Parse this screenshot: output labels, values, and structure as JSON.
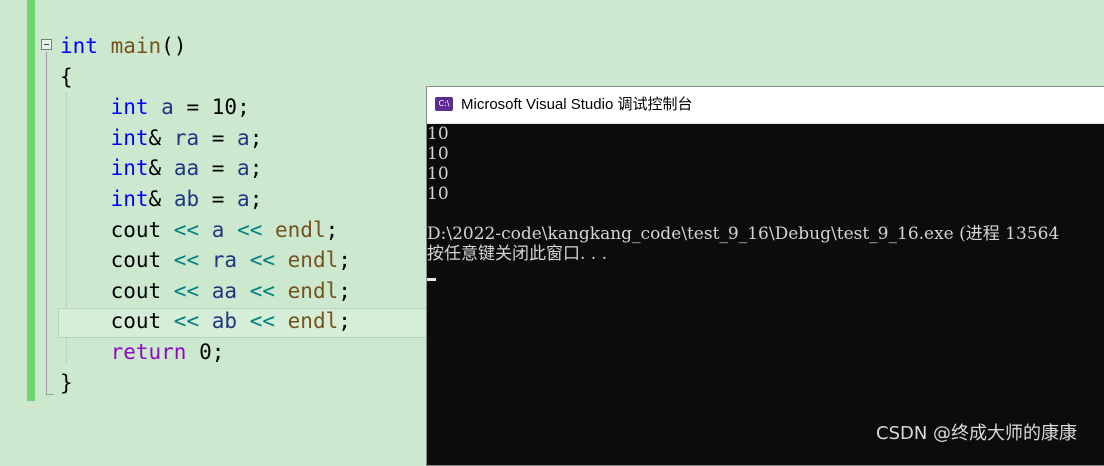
{
  "editor": {
    "lines": [
      {
        "parts": [
          {
            "t": "int",
            "c": "kw"
          },
          {
            "t": " "
          },
          {
            "t": "main",
            "c": "fn"
          },
          {
            "t": "()"
          }
        ]
      },
      {
        "parts": [
          {
            "t": "{"
          }
        ]
      },
      {
        "parts": [
          {
            "t": "    "
          },
          {
            "t": "int",
            "c": "kw"
          },
          {
            "t": " "
          },
          {
            "t": "a",
            "c": "var"
          },
          {
            "t": " = "
          },
          {
            "t": "10",
            "c": "num"
          },
          {
            "t": ";"
          }
        ]
      },
      {
        "parts": [
          {
            "t": "    "
          },
          {
            "t": "int",
            "c": "kw"
          },
          {
            "t": "& "
          },
          {
            "t": "ra",
            "c": "var"
          },
          {
            "t": " = "
          },
          {
            "t": "a",
            "c": "var"
          },
          {
            "t": ";"
          }
        ]
      },
      {
        "parts": [
          {
            "t": "    "
          },
          {
            "t": "int",
            "c": "kw"
          },
          {
            "t": "& "
          },
          {
            "t": "aa",
            "c": "var"
          },
          {
            "t": " = "
          },
          {
            "t": "a",
            "c": "var"
          },
          {
            "t": ";"
          }
        ]
      },
      {
        "parts": [
          {
            "t": "    "
          },
          {
            "t": "int",
            "c": "kw"
          },
          {
            "t": "& "
          },
          {
            "t": "ab",
            "c": "var"
          },
          {
            "t": " = "
          },
          {
            "t": "a",
            "c": "var"
          },
          {
            "t": ";"
          }
        ]
      },
      {
        "parts": [
          {
            "t": "    cout "
          },
          {
            "t": "<<",
            "c": "op"
          },
          {
            "t": " "
          },
          {
            "t": "a",
            "c": "var"
          },
          {
            "t": " "
          },
          {
            "t": "<<",
            "c": "op"
          },
          {
            "t": " "
          },
          {
            "t": "endl",
            "c": "fn"
          },
          {
            "t": ";"
          }
        ]
      },
      {
        "parts": [
          {
            "t": "    cout "
          },
          {
            "t": "<<",
            "c": "op"
          },
          {
            "t": " "
          },
          {
            "t": "ra",
            "c": "var"
          },
          {
            "t": " "
          },
          {
            "t": "<<",
            "c": "op"
          },
          {
            "t": " "
          },
          {
            "t": "endl",
            "c": "fn"
          },
          {
            "t": ";"
          }
        ]
      },
      {
        "parts": [
          {
            "t": "    cout "
          },
          {
            "t": "<<",
            "c": "op"
          },
          {
            "t": " "
          },
          {
            "t": "aa",
            "c": "var"
          },
          {
            "t": " "
          },
          {
            "t": "<<",
            "c": "op"
          },
          {
            "t": " "
          },
          {
            "t": "endl",
            "c": "fn"
          },
          {
            "t": ";"
          }
        ]
      },
      {
        "parts": [
          {
            "t": "    cout "
          },
          {
            "t": "<<",
            "c": "op"
          },
          {
            "t": " "
          },
          {
            "t": "ab",
            "c": "var"
          },
          {
            "t": " "
          },
          {
            "t": "<<",
            "c": "op"
          },
          {
            "t": " "
          },
          {
            "t": "endl",
            "c": "fn"
          },
          {
            "t": ";"
          }
        ]
      },
      {
        "parts": [
          {
            "t": "    "
          },
          {
            "t": "return",
            "c": "ctl"
          },
          {
            "t": " "
          },
          {
            "t": "0",
            "c": "num"
          },
          {
            "t": ";"
          }
        ]
      },
      {
        "parts": [
          {
            "t": "}"
          }
        ]
      }
    ]
  },
  "console": {
    "icon_label": "C:\\",
    "title": "Microsoft Visual Studio 调试控制台",
    "output": [
      "10",
      "10",
      "10",
      "10",
      "",
      "D:\\2022-code\\kangkang_code\\test_9_16\\Debug\\test_9_16.exe (进程 13564",
      "按任意键关闭此窗口. . ."
    ]
  },
  "watermark": "CSDN @终成大师的康康",
  "colors": {
    "editor_bg": "#cce8cf",
    "change_bar": "#6fd66f",
    "keyword": "#0000ff",
    "control": "#8f08c4",
    "function": "#74531f",
    "variable": "#1f377f",
    "operator": "#008080",
    "console_bg": "#0c0c0c",
    "console_text": "#d4d4d4"
  }
}
